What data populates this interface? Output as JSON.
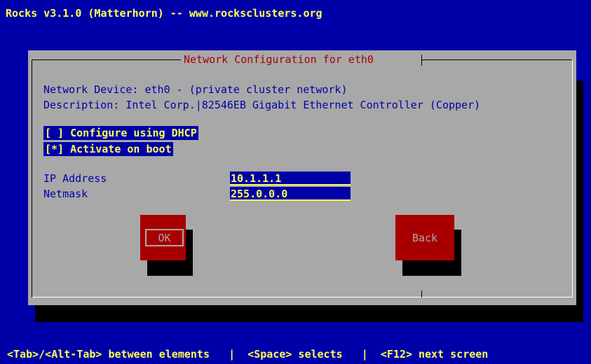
{
  "app": {
    "title": "Rocks v3.1.0 (Matterhorn) -- www.rocksclusters.org"
  },
  "dialog": {
    "title": "Network Configuration for eth0",
    "device_line": "Network Device: eth0 - (private cluster network)",
    "description_line": "Description: Intel Corp.|82546EB Gigabit Ethernet Controller (Copper)",
    "checkboxes": [
      {
        "label": "[ ] Configure using DHCP",
        "checked": false
      },
      {
        "label": "[*] Activate on boot",
        "checked": true
      }
    ],
    "fields": [
      {
        "label": "IP Address",
        "value": "10.1.1.1"
      },
      {
        "label": "Netmask",
        "value": "255.0.0.0"
      }
    ],
    "buttons": {
      "ok": "OK",
      "back": "Back"
    }
  },
  "help_line": "<Tab>/<Alt-Tab> between elements   |  <Space> selects   |  <F12> next screen",
  "colors": {
    "background": "#0000a8",
    "dialog": "#a8a8a8",
    "accent_text": "#ffff55",
    "button": "#a80000"
  }
}
